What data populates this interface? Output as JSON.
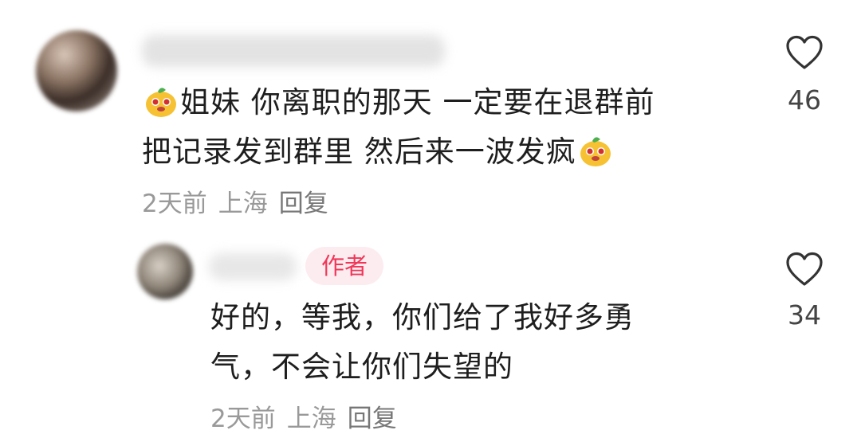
{
  "comment": {
    "line1": "姐妹 你离职的那天 一定要在退群前",
    "line2": "把记录发到群里 然后来一波发疯",
    "time": "2天前",
    "location": "上海",
    "reply_label": "回复",
    "like_count": "46"
  },
  "reply": {
    "badge": "作者",
    "line1": "好的，等我，你们给了我好多勇",
    "line2": "气，不会让你们失望的",
    "time": "2天前",
    "location": "上海",
    "reply_label": "回复",
    "like_count": "34"
  },
  "icons": {
    "like": "heart-outline-icon",
    "emoji": "mascot-emoji-icon"
  },
  "colors": {
    "author_badge_text": "#f0375a",
    "author_badge_bg": "#fdecef",
    "meta_text": "#999999"
  }
}
